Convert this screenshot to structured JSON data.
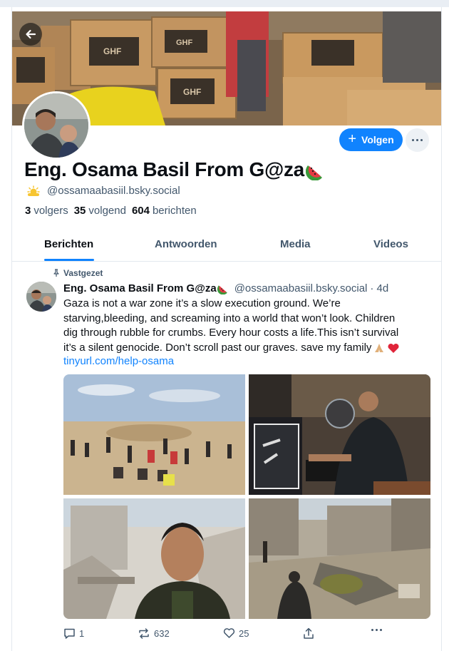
{
  "profile": {
    "display_name": "Eng. Osama Basil From G@za",
    "name_emoji": "watermelon",
    "handle": "@ossamaabasiil.bsky.social",
    "handle_emoji": "sun-behind-cloud",
    "banner_box_label": "GHF",
    "follow_label": "Volgen",
    "stats": [
      {
        "value": "3",
        "label": "volgers"
      },
      {
        "value": "35",
        "label": "volgend"
      },
      {
        "value": "604",
        "label": "berichten"
      }
    ]
  },
  "tabs": [
    {
      "label": "Berichten",
      "active": true
    },
    {
      "label": "Antwoorden",
      "active": false
    },
    {
      "label": "Media",
      "active": false
    },
    {
      "label": "Videos",
      "active": false
    }
  ],
  "post": {
    "pinned_label": "Vastgezet",
    "author_name": "Eng. Osama Basil From G@za",
    "author_handle": "@ossamaabasiil.bsky.social",
    "time": "· 4d",
    "text_lines": [
      "Gaza is not a war zone it’s a slow execution ground. We’re",
      "starving,bleeding, and screaming into a world that won’t look. Children",
      "dig through rubble for crumbs. Every hour costs a life.This isn’t survival",
      "it’s a silent genocide. Don’t scroll past our graves. save my family"
    ],
    "text_emojis": [
      "folded-hands",
      "red-heart"
    ],
    "link": "tinyurl.com/help-osama",
    "images": [
      {
        "description_name": "crowd-on-sand-photo"
      },
      {
        "description_name": "man-at-computer-photo"
      },
      {
        "description_name": "selfie-in-rubble-photo"
      },
      {
        "description_name": "destroyed-buildings-photo"
      }
    ],
    "counts": {
      "replies": "1",
      "reposts": "632",
      "likes": "25"
    }
  },
  "icons": {
    "back": "arrow-left-icon",
    "follow": "plus-icon",
    "more": "more-horizontal-icon",
    "pin": "pin-icon",
    "reply": "speech-bubble-icon",
    "repost": "repost-icon",
    "like": "heart-icon",
    "share": "share-icon",
    "post_more": "ellipsis-icon"
  },
  "colors": {
    "accent": "#1083fe",
    "text": "#0b0f14",
    "muted": "#42576c",
    "border": "#e3e8ee"
  }
}
